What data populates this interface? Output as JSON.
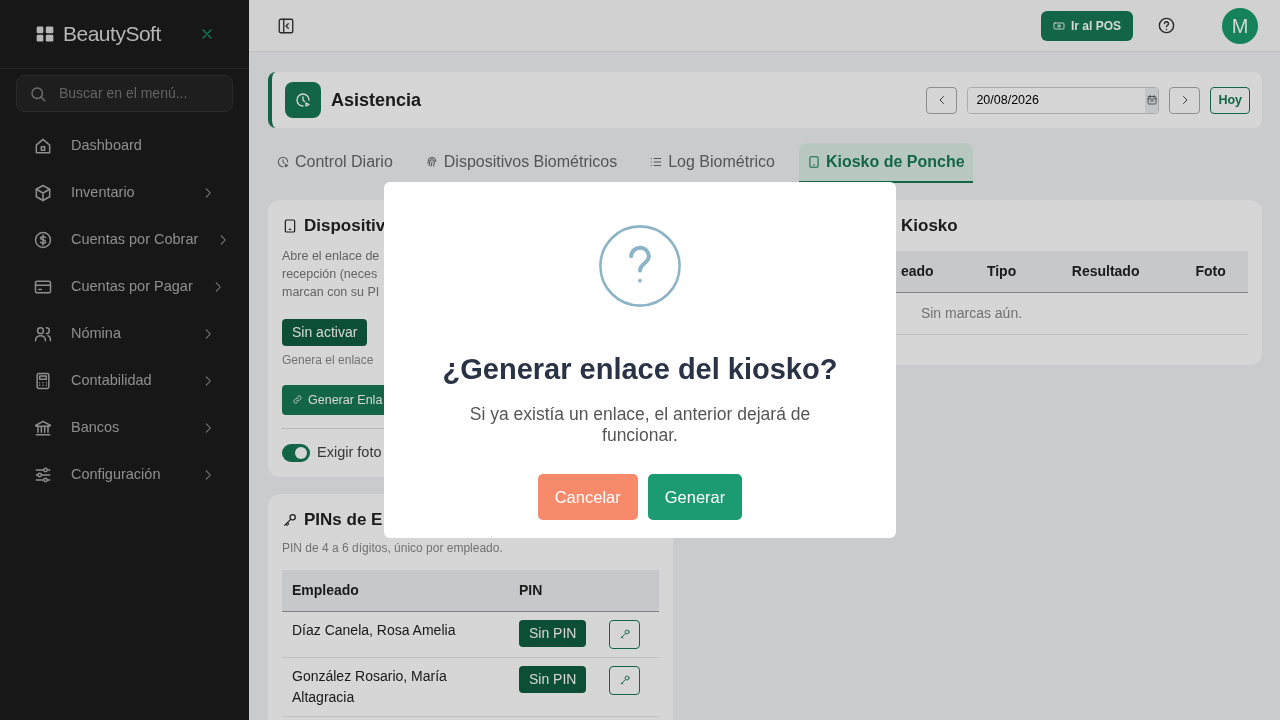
{
  "sidebar": {
    "brand": "BeautySoft",
    "search": {
      "placeholder": "Buscar en el menú..."
    },
    "items": [
      {
        "label": "Dashboard",
        "expandable": false
      },
      {
        "label": "Inventario",
        "expandable": true
      },
      {
        "label": "Cuentas por Cobrar",
        "expandable": true
      },
      {
        "label": "Cuentas por Pagar",
        "expandable": true
      },
      {
        "label": "Nómina",
        "expandable": true
      },
      {
        "label": "Contabilidad",
        "expandable": true
      },
      {
        "label": "Bancos",
        "expandable": true
      },
      {
        "label": "Configuración",
        "expandable": true
      }
    ]
  },
  "topbar": {
    "pos_button": "Ir al POS",
    "avatar": "M"
  },
  "page_header": {
    "title": "Asistencia",
    "date": "20/08/2026",
    "today_button": "Hoy"
  },
  "tabs": [
    {
      "label": "Control Diario",
      "selected": false
    },
    {
      "label": "Dispositivos Biométricos",
      "selected": false
    },
    {
      "label": "Log Biométrico",
      "selected": false
    },
    {
      "label": "Kiosko de Ponche",
      "selected": true
    }
  ],
  "device_card": {
    "title": "Dispositiv",
    "description_lines": [
      "Abre el enlace de",
      "recepción (neces",
      "marcan con su PI"
    ],
    "status_badge": "Sin activar",
    "hint": "Genera el enlace",
    "generate_button": "Generar Enla",
    "photo_toggle": {
      "label": "Exigir foto",
      "on": true
    }
  },
  "pins_card": {
    "title": "PINs de E",
    "subtitle": "PIN de 4 a 6 dígitos, único por empleado.",
    "columns": [
      "Empleado",
      "PIN"
    ],
    "rows": [
      {
        "employee": "Díaz Canela, Rosa Amelia",
        "pin_status": "Sin PIN"
      },
      {
        "employee": "González Rosario, María Altagracia",
        "pin_status": "Sin PIN"
      }
    ]
  },
  "marks_card": {
    "title": "Kiosko",
    "columns": [
      "eado",
      "Tipo",
      "Resultado",
      "Foto"
    ],
    "empty_message": "Sin marcas aún."
  },
  "dialog": {
    "title": "¿Generar enlace del kiosko?",
    "message": "Si ya existía un enlace, el anterior dejará de funcionar.",
    "buttons": [
      {
        "label": "Cancelar",
        "kind": "cancel"
      },
      {
        "label": "Generar",
        "kind": "confirm"
      }
    ]
  }
}
